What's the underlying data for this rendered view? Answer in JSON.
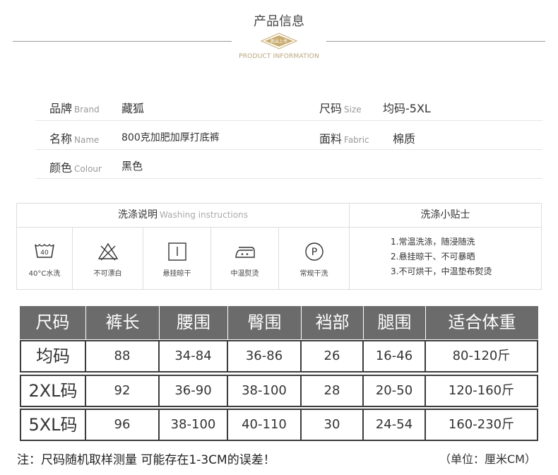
{
  "header": {
    "title": "产品信息",
    "badge_text": "新品上市",
    "subtitle": "PRODUCT INFORMATION",
    "accent_color": "#c8ab6e"
  },
  "info": {
    "rows": [
      {
        "label1": "品牌",
        "label1_en": "Brand",
        "value1": "藏狐",
        "label2": "尺码",
        "label2_en": "Size",
        "value2": "均码-5XL"
      },
      {
        "label1": "名称",
        "label1_en": "Name",
        "value1": "800克加肥加厚打底裤",
        "label2": "面料",
        "label2_en": "Fabric",
        "value2": "棉质"
      },
      {
        "label1": "颜色",
        "label1_en": "Colour",
        "value1": "黑色",
        "label2": "",
        "label2_en": "",
        "value2": ""
      }
    ]
  },
  "washing": {
    "title": "洗涤说明",
    "title_en": "Washing instructions",
    "tips_title": "洗涤小贴士",
    "icons": [
      {
        "icon": "wash-40-icon",
        "number": "40",
        "label": "40°C水洗"
      },
      {
        "icon": "no-bleach-icon",
        "label": "不可漂白"
      },
      {
        "icon": "hang-dry-icon",
        "label": "悬挂晾干"
      },
      {
        "icon": "iron-medium-icon",
        "label": "中温熨烫"
      },
      {
        "icon": "dry-clean-icon",
        "letter": "P",
        "label": "常规干洗"
      }
    ],
    "tips": [
      "1.常温洗涤，随浸随洗",
      "2.悬挂晾干、不可暴晒",
      "3.不可烘干，中温垫布熨烫"
    ]
  },
  "size_table": {
    "header_color": "#6b6b6b",
    "columns": [
      "尺码",
      "裤长",
      "腰围",
      "臀围",
      "裆部",
      "腿围",
      "适合体重"
    ],
    "rows": [
      [
        "均码",
        "88",
        "34-84",
        "36-86",
        "26",
        "16-46",
        "80-120斤"
      ],
      [
        "2XL码",
        "92",
        "36-90",
        "38-100",
        "28",
        "20-50",
        "120-160斤"
      ],
      [
        "5XL码",
        "96",
        "38-100",
        "40-110",
        "30",
        "24-54",
        "160-230斤"
      ]
    ]
  },
  "footer": {
    "note": "注：尺码随机取样测量 可能存在1-3CM的误差！",
    "unit": "（单位：厘米CM）"
  }
}
